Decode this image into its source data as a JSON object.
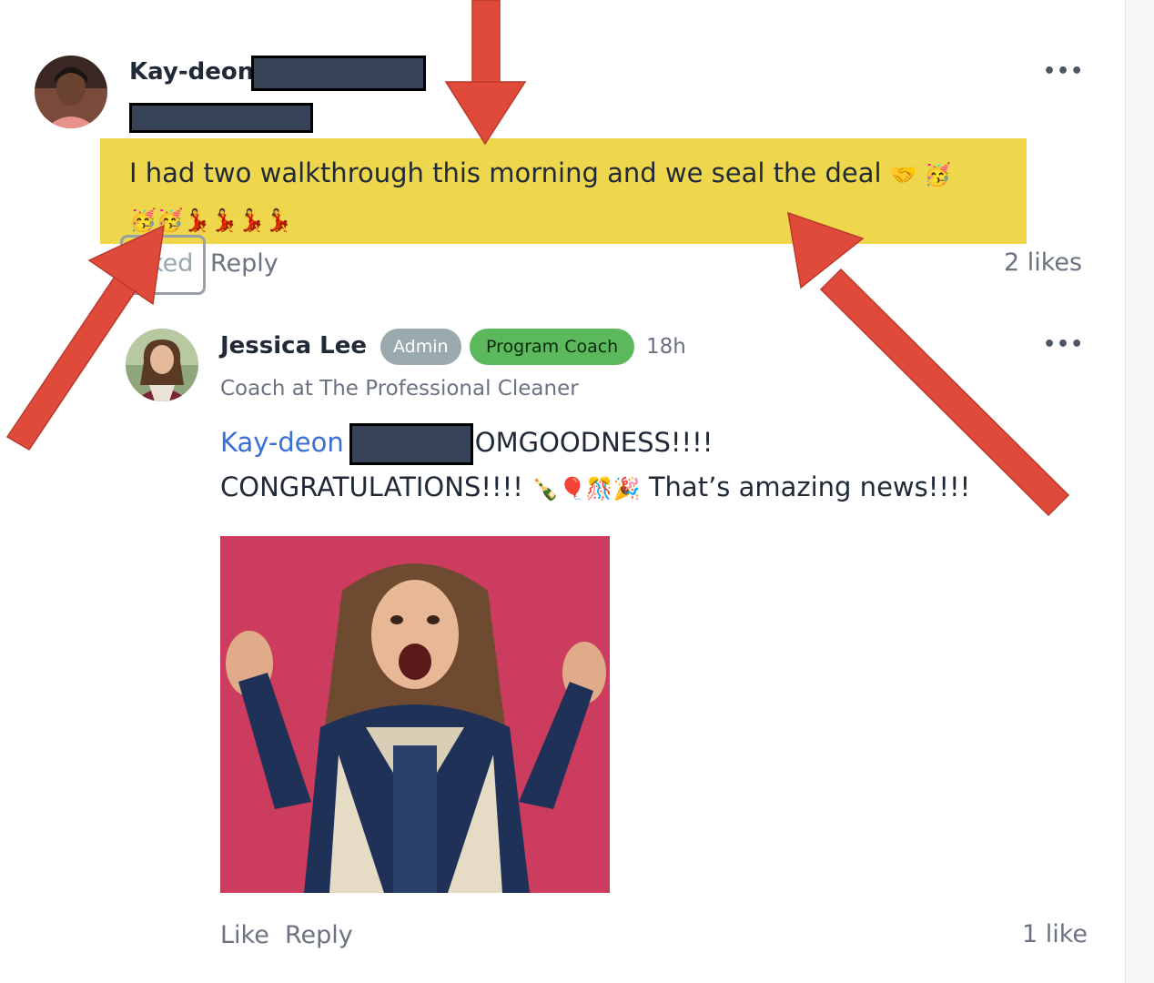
{
  "comment": {
    "author": "Kay-deon",
    "text": "I had two walkthrough this morning and we seal the deal",
    "emojis_line1": "🤝 🥳",
    "emojis_line2": "🥳🥳💃💃💃💃",
    "liked_label": "ked",
    "reply_label": "Reply",
    "likes": "2 likes",
    "more": "•••"
  },
  "reply": {
    "author": "Jessica Lee",
    "badge_admin": "Admin",
    "badge_coach": "Program Coach",
    "time": "18h",
    "subtitle": "Coach at The Professional Cleaner",
    "mention": "Kay-deon",
    "text_part1": "OMGOODNESS!!!!",
    "text_part2": "CONGRATULATIONS!!!!",
    "emojis": "🍾🎈🎊🎉",
    "text_part3": "That’s amazing news!!!!",
    "like_label": "Like",
    "reply_label": "Reply",
    "likes": "1 like",
    "more": "•••"
  },
  "annotation_color": "#e04a3a",
  "highlight_color": "#efd74d"
}
